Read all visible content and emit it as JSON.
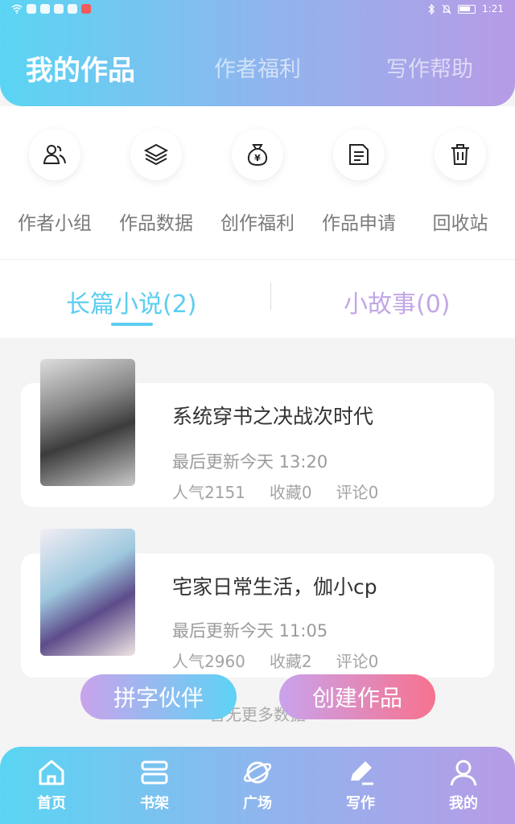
{
  "status_bar": {
    "time": "1:21"
  },
  "header_tabs": [
    {
      "label": "我的作品"
    },
    {
      "label": "作者福利"
    },
    {
      "label": "写作帮助"
    }
  ],
  "tools": [
    {
      "label": "作者小组",
      "icon": "people-icon"
    },
    {
      "label": "作品数据",
      "icon": "layers-icon"
    },
    {
      "label": "创作福利",
      "icon": "money-bag-icon"
    },
    {
      "label": "作品申请",
      "icon": "document-icon"
    },
    {
      "label": "回收站",
      "icon": "trash-icon"
    }
  ],
  "story_tabs": [
    {
      "label": "长篇小说(2)"
    },
    {
      "label": "小故事(0)"
    }
  ],
  "works": [
    {
      "title": "系统穿书之决战次时代",
      "updated": "最后更新今天 13:20",
      "popularity": "人气2151",
      "favorites": "收藏0",
      "comments": "评论0"
    },
    {
      "title": "宅家日常生活，伽小cp",
      "updated": "最后更新今天 11:05",
      "popularity": "人气2960",
      "favorites": "收藏2",
      "comments": "评论0"
    }
  ],
  "no_more": "暂无更多数据",
  "float_buttons": {
    "match": "拼字伙伴",
    "create": "创建作品"
  },
  "bottom_nav": [
    {
      "label": "首页",
      "icon": "home-icon"
    },
    {
      "label": "书架",
      "icon": "bookshelf-icon"
    },
    {
      "label": "广场",
      "icon": "planet-icon"
    },
    {
      "label": "写作",
      "icon": "pen-icon"
    },
    {
      "label": "我的",
      "icon": "profile-icon"
    }
  ],
  "colors": {
    "accent_blue": "#5ccdf0",
    "accent_purple": "#c2a7e6",
    "accent_pink": "#f7728e"
  }
}
